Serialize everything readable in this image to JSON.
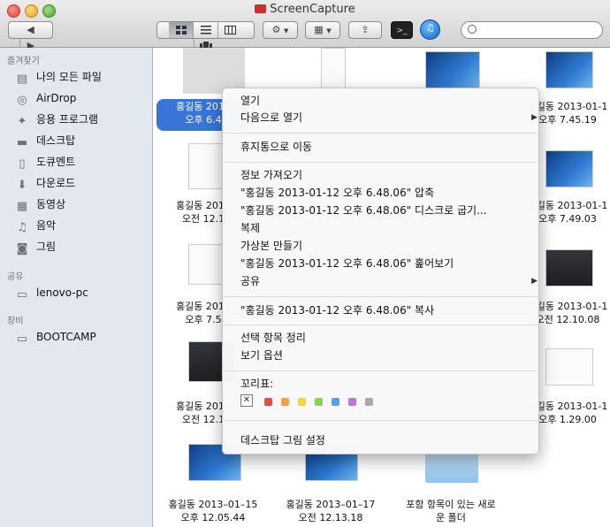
{
  "window": {
    "title": "ScreenCapture"
  },
  "toolbar": {
    "view_modes": [
      "icon-view",
      "list-view",
      "column-view",
      "cover-flow-view"
    ]
  },
  "sidebar": {
    "sections": [
      {
        "heading": "즐겨찾기",
        "items": [
          {
            "label": "나의 모든 파일",
            "icon": "all-files-icon"
          },
          {
            "label": "AirDrop",
            "icon": "airdrop-icon"
          },
          {
            "label": "응용 프로그램",
            "icon": "applications-icon"
          },
          {
            "label": "데스크탑",
            "icon": "desktop-icon"
          },
          {
            "label": "도큐멘트",
            "icon": "documents-icon"
          },
          {
            "label": "다운로드",
            "icon": "downloads-icon"
          },
          {
            "label": "동영상",
            "icon": "movies-icon"
          },
          {
            "label": "음악",
            "icon": "music-icon"
          },
          {
            "label": "그림",
            "icon": "pictures-icon"
          }
        ]
      },
      {
        "heading": "공유",
        "items": [
          {
            "label": "lenovo-pc",
            "icon": "pc-icon"
          }
        ]
      },
      {
        "heading": "장비",
        "items": [
          {
            "label": "BOOTCAMP",
            "icon": "disk-icon"
          }
        ]
      }
    ]
  },
  "files": [
    {
      "line1": "홍길동 2013",
      "line2": "오후 6.4",
      "selected": true
    },
    {
      "line1": "홍길동 2013-01-1",
      "line2": "오후 7.45.19"
    },
    {
      "line1": "홍길동 2013",
      "line2": "오전 12.1"
    },
    {
      "line1": "홍길동 2013-01-1",
      "line2": "오후 7.49.03"
    },
    {
      "line1": "홍길동 2013",
      "line2": "오후 7.5"
    },
    {
      "line1": "홍길동 2013-01-1",
      "line2": "오전 12.10.08"
    },
    {
      "line1": "홍길동 2013",
      "line2": "오전 12.1"
    },
    {
      "line1": "홍길동 2013-01-1",
      "line2": "오후 1.29.00"
    },
    {
      "line1": "홍길동 2013–01–15",
      "line2": "오후 12.05.44"
    },
    {
      "line1": "홍길동 2013–01–17",
      "line2": "오전 12.13.18"
    },
    {
      "line1": "포함 항목이 있는 새로",
      "line2": "운 폴더"
    }
  ],
  "context_menu": {
    "open": "열기",
    "open_with": "다음으로 열기",
    "move_to_trash": "휴지통으로 이동",
    "get_info": "정보 가져오기",
    "compress": "\"홍길동 2013-01-12 오후 6.48.06\" 압축",
    "burn": "\"홍길동 2013-01-12 오후 6.48.06\" 디스크로 굽기...",
    "duplicate": "복제",
    "make_alias": "가상본 만들기",
    "quick_look": "\"홍길동 2013-01-12 오후 6.48.06\" 훑어보기",
    "share": "공유",
    "copy": "\"홍길동 2013-01-12 오후 6.48.06\" 복사",
    "clean_up": "선택 항목 정리",
    "view_options": "보기 옵션",
    "tags_label": "꼬리표:",
    "tag_colors": [
      "#e0504a",
      "#f2a14a",
      "#f2d14a",
      "#8ed05a",
      "#5aa0e8",
      "#b67ad8",
      "#a8a8a8"
    ],
    "desktop_picture": "데스크탑 그림 설정"
  }
}
